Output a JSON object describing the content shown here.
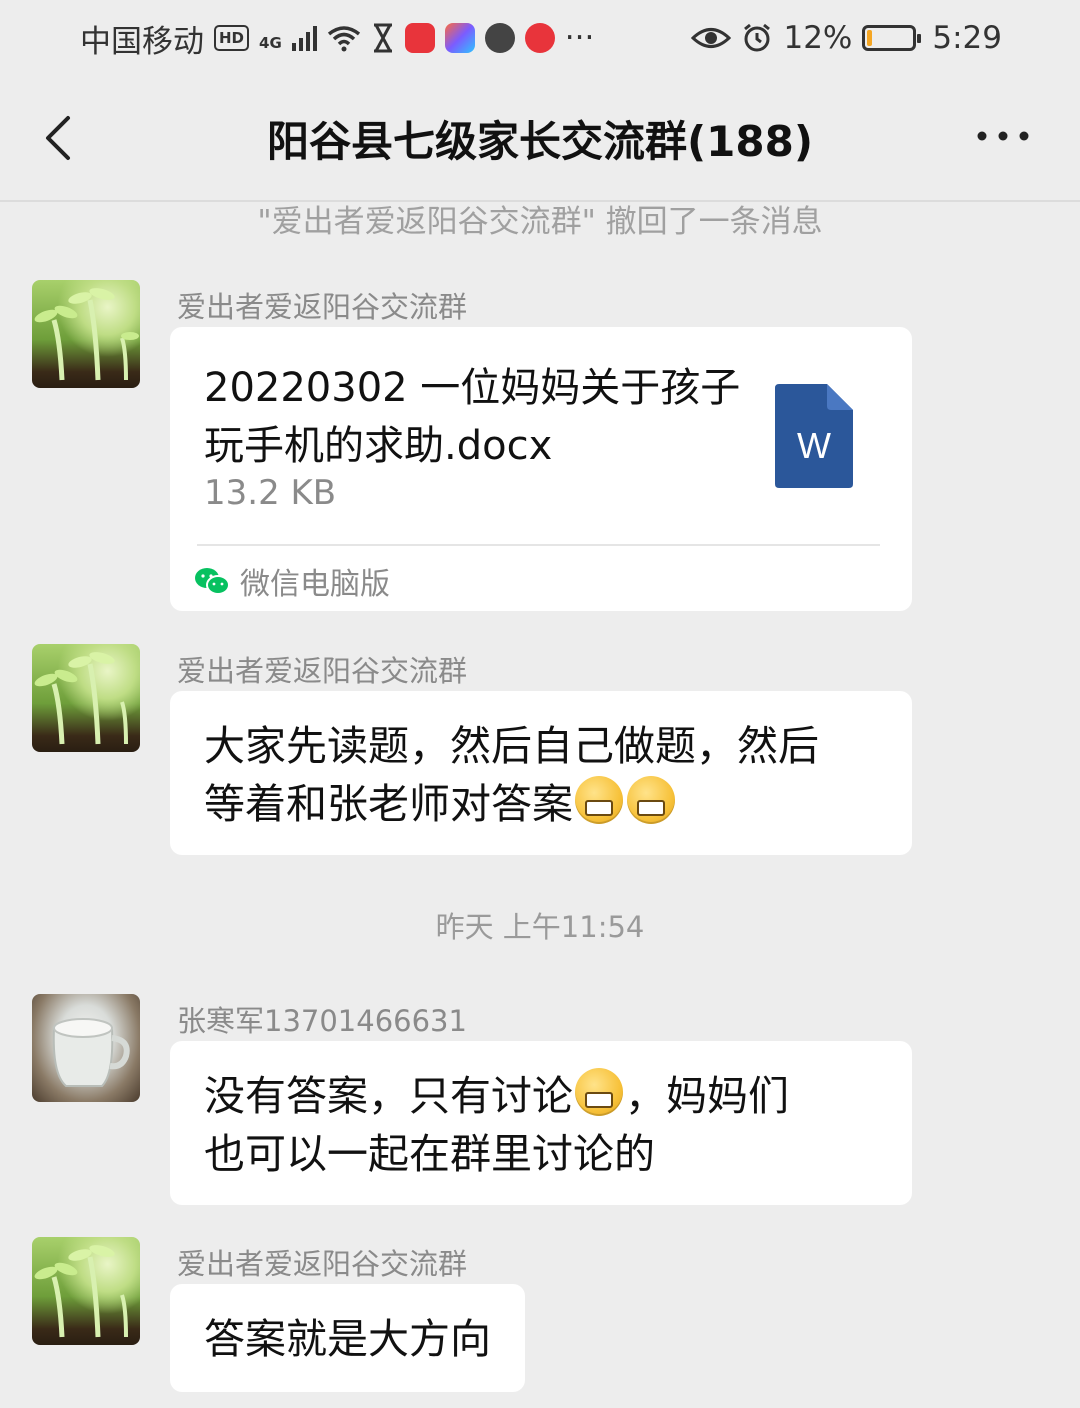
{
  "status_bar": {
    "carrier": "中国移动",
    "hd": "HD",
    "network": "4G",
    "battery": "12%",
    "battery_level": 0.12,
    "time": "5:29",
    "more": "···"
  },
  "header": {
    "title": "阳谷县七级家长交流群(188)",
    "back_icon": "chevron-left-icon",
    "more_icon": "more-horizontal-icon"
  },
  "system_message": "\"爱出者爱返阳谷交流群\" 撤回了一条消息",
  "messages": [
    {
      "sender": "爱出者爱返阳谷交流群",
      "type": "file",
      "file_name": "20220302 一位妈妈关于孩子玩手机的求助.docx",
      "file_size": "13.2 KB",
      "file_icon": "word-document-icon",
      "file_icon_letter": "W",
      "source": "微信电脑版"
    },
    {
      "sender": "爱出者爱返阳谷交流群",
      "type": "text",
      "text_line1": "大家先读题，然后自己做题，然后",
      "text_line2": "等着和张老师对答案"
    },
    {
      "sender": "张寒军13701466631",
      "type": "text",
      "text_part1": "没有答案，只有讨论",
      "text_part2": "，妈妈们",
      "text_line2": "也可以一起在群里讨论的"
    },
    {
      "sender": "爱出者爱返阳谷交流群",
      "type": "text",
      "text": "答案就是大方向"
    }
  ],
  "timestamp": "昨天 上午11:54",
  "colors": {
    "background": "#ededed",
    "bubble": "#ffffff",
    "word_blue": "#2b579a",
    "wechat_green": "#07c160"
  }
}
